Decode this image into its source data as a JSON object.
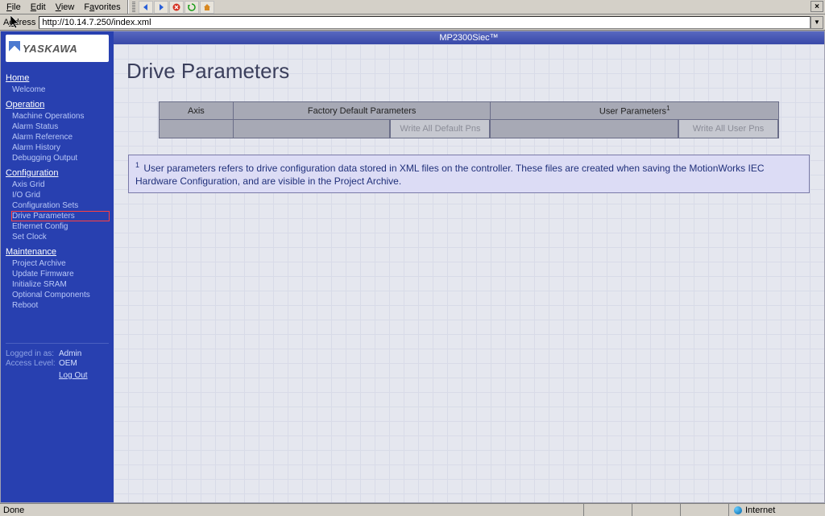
{
  "browser": {
    "menu": {
      "file": "File",
      "edit": "Edit",
      "view": "View",
      "favorites": "Favorites"
    },
    "toolbar": {
      "back": "back-arrow",
      "forward": "forward-arrow",
      "stop": "stop",
      "refresh": "refresh",
      "home": "home"
    },
    "close_label": "×",
    "address_label": "Address",
    "address_value": "http://10.14.7.250/index.xml",
    "dropdown_glyph": "▼"
  },
  "sidebar": {
    "brand": "YASKAWA",
    "sections": [
      {
        "title": "Home",
        "items": [
          {
            "label": "Welcome"
          }
        ]
      },
      {
        "title": "Operation",
        "items": [
          {
            "label": "Machine Operations"
          },
          {
            "label": "Alarm Status"
          },
          {
            "label": "Alarm Reference"
          },
          {
            "label": "Alarm History"
          },
          {
            "label": "Debugging Output"
          }
        ]
      },
      {
        "title": "Configuration",
        "items": [
          {
            "label": "Axis Grid"
          },
          {
            "label": "I/O Grid"
          },
          {
            "label": "Configuration Sets"
          },
          {
            "label": "Drive Parameters",
            "highlighted": true
          },
          {
            "label": "Ethernet Config"
          },
          {
            "label": "Set Clock"
          }
        ]
      },
      {
        "title": "Maintenance",
        "items": [
          {
            "label": "Project Archive"
          },
          {
            "label": "Update Firmware"
          },
          {
            "label": "Initialize SRAM"
          },
          {
            "label": "Optional Components"
          },
          {
            "label": "Reboot"
          }
        ]
      }
    ],
    "session": {
      "logged_in_as_label": "Logged in as:",
      "logged_in_as_value": "Admin",
      "access_level_label": "Access Level:",
      "access_level_value": "OEM",
      "logout_label": "Log Out"
    }
  },
  "main": {
    "titlebar": "MP2300Siec™",
    "page_title": "Drive Parameters",
    "table": {
      "h_axis": "Axis",
      "h_factory": "Factory Default Parameters",
      "h_user": "User Parameters",
      "h_user_sup": "1",
      "btn_default": "Write All Default Pns",
      "btn_user": "Write All User Pns"
    },
    "footnote": {
      "sup": "1",
      "text": "User parameters refers to drive configuration data stored in XML files on the controller. These files are created when saving the MotionWorks IEC Hardware Configuration, and are visible in the Project Archive."
    }
  },
  "statusbar": {
    "left": "Done",
    "zone": "Internet"
  }
}
